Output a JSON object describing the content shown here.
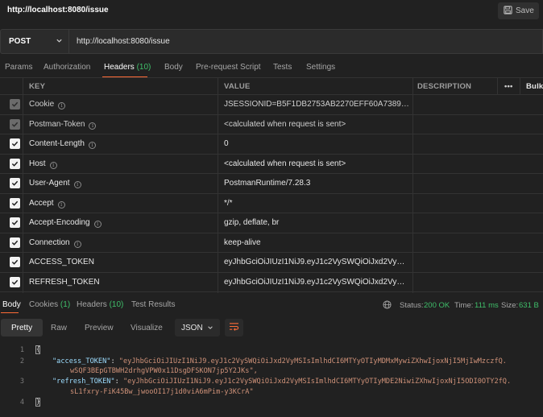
{
  "request": {
    "title": "http://localhost:8080/issue",
    "save_label": "Save",
    "method": "POST",
    "url": "http://localhost:8080/issue"
  },
  "request_tabs": [
    {
      "label": "Params"
    },
    {
      "label": "Authorization"
    },
    {
      "label": "Headers",
      "count": "(10)"
    },
    {
      "label": "Body"
    },
    {
      "label": "Pre-request Script"
    },
    {
      "label": "Tests"
    },
    {
      "label": "Settings"
    }
  ],
  "headers_table": {
    "columns": {
      "key": "KEY",
      "value": "VALUE",
      "description": "DESCRIPTION",
      "bulk": "Bulk",
      "more": "•••"
    },
    "rows": [
      {
        "key": "Cookie",
        "value": "JSESSIONID=B5F1DB2753AB2270EFF60A7389EDFF...",
        "checked": true,
        "dim": true
      },
      {
        "key": "Postman-Token",
        "value": "<calculated when request is sent>",
        "checked": true,
        "dim": true
      },
      {
        "key": "Content-Length",
        "value": "0",
        "checked": true,
        "dim": false
      },
      {
        "key": "Host",
        "value": "<calculated when request is sent>",
        "checked": true,
        "dim": false
      },
      {
        "key": "User-Agent",
        "value": "PostmanRuntime/7.28.3",
        "checked": true,
        "dim": false
      },
      {
        "key": "Accept",
        "value": "*/*",
        "checked": true,
        "dim": false
      },
      {
        "key": "Accept-Encoding",
        "value": "gzip, deflate, br",
        "checked": true,
        "dim": false
      },
      {
        "key": "Connection",
        "value": "keep-alive",
        "checked": true,
        "dim": false
      },
      {
        "key": "ACCESS_TOKEN",
        "value": "eyJhbGciOiJIUzI1NiJ9.eyJ1c2VySWQiOiJxd2VyMSIsI...",
        "checked": true,
        "dim": false
      },
      {
        "key": "REFRESH_TOKEN",
        "value": "eyJhbGciOiJIUzI1NiJ9.eyJ1c2VySWQiOiJxd2VyMSIsI...",
        "checked": true,
        "dim": false
      }
    ]
  },
  "response_tabs": [
    {
      "label": "Body"
    },
    {
      "label": "Cookies",
      "count": "(1)"
    },
    {
      "label": "Headers",
      "count": "(10)"
    },
    {
      "label": "Test Results"
    }
  ],
  "response_status": {
    "status_label": "Status:",
    "status_value": "200 OK",
    "time_label": "Time:",
    "time_value": "111 ms",
    "size_label": "Size:",
    "size_value": "631 B"
  },
  "view_modes": [
    "Pretty",
    "Raw",
    "Preview",
    "Visualize"
  ],
  "format": "JSON",
  "response_body": {
    "line_numbers": [
      "1",
      "2",
      "3",
      "4"
    ],
    "open_brace": "{",
    "close_brace": "}",
    "access_key": "\"access_TOKEN\"",
    "access_value_1": "\"eyJhbGciOiJIUzI1NiJ9.eyJ1c2VySWQiOiJxd2VyMSIsImlhdCI6MTYyOTIyMDMxMywiZXhwIjoxNjI5MjIwMzczfQ.",
    "access_value_2": "wSQF3BEpGTBWH2drhgVPW0x11DsgDFSKON7jp5Y2JKs\",",
    "refresh_key": "\"refresh_TOKEN\"",
    "refresh_value_1": "\"eyJhbGciOiJIUzI1NiJ9.eyJ1c2VySWQiOiJxd2VyMSIsImlhdCI6MTYyOTIyMDE2NiwiZXhwIjoxNjI5ODI0OTY2fQ.",
    "refresh_value_2": "sL1fxry-FiK45Bw_jwooOI17j1d0viA6mPim-y3KCrA\""
  },
  "colors": {
    "accent": "#ff6c37",
    "success": "#3fbf6a",
    "background": "#212121"
  }
}
